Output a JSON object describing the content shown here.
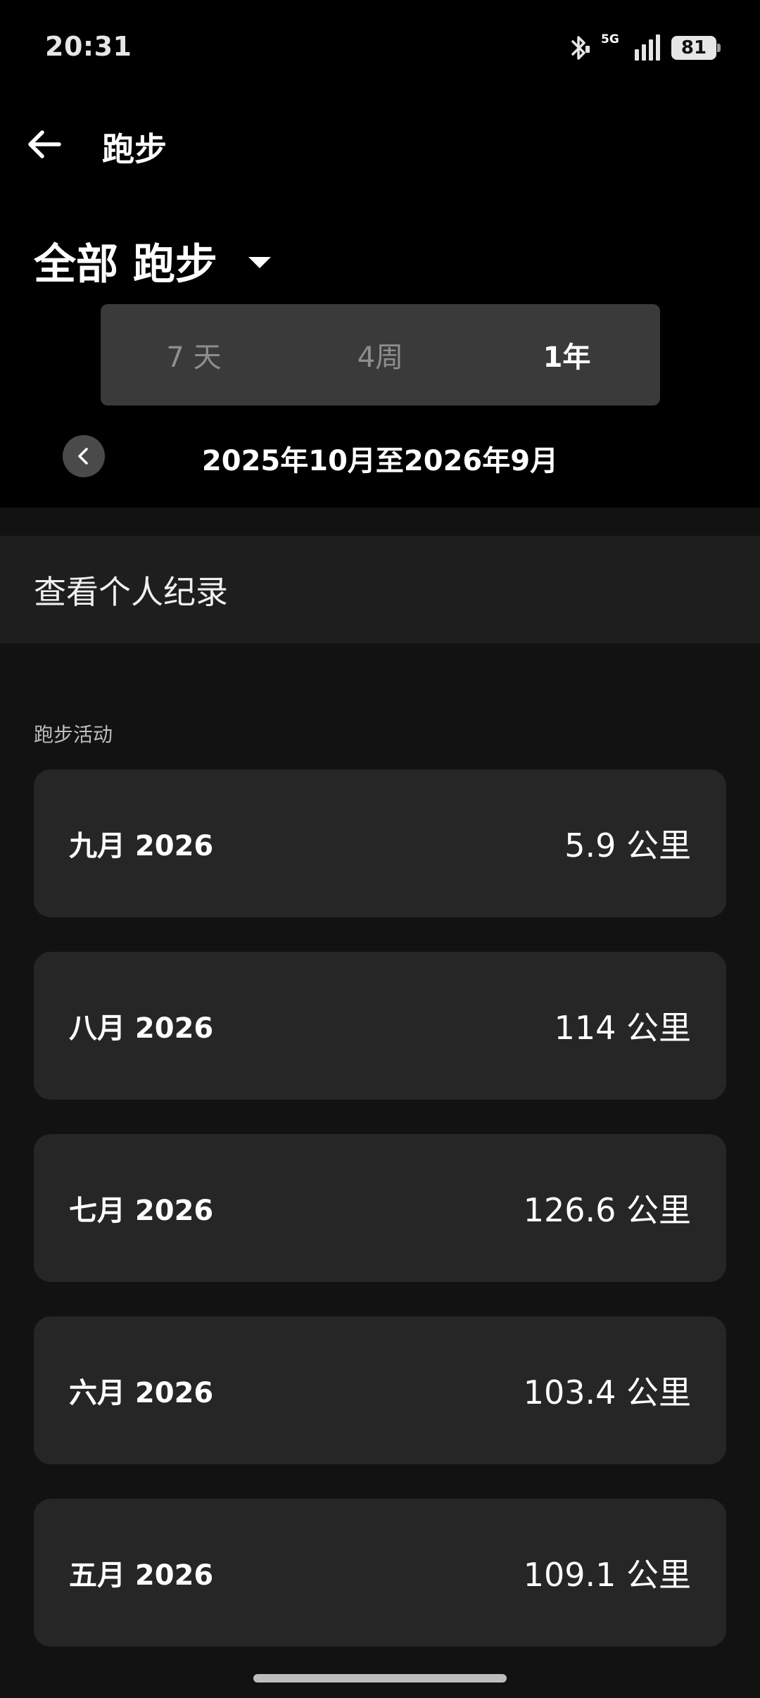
{
  "status_bar": {
    "time": "20:31",
    "network": "5G",
    "battery": "81",
    "icons": [
      "bluetooth-icon",
      "signal-icon",
      "battery-icon"
    ]
  },
  "header": {
    "title": "跑步",
    "back_icon": "arrow-left-icon"
  },
  "filter": {
    "label": "全部 跑步",
    "icon": "caret-down-icon"
  },
  "range_tabs": [
    {
      "label": "7 天",
      "selected": false
    },
    {
      "label": "4周",
      "selected": false
    },
    {
      "label": "1年",
      "selected": true
    }
  ],
  "period": {
    "label": "2025年10月至2026年9月",
    "prev_icon": "chevron-left-icon"
  },
  "personal_records": {
    "label": "查看个人纪录"
  },
  "activities": {
    "section_label": "跑步活动",
    "months": [
      {
        "month": "九月 2026",
        "distance": "5.9 公里"
      },
      {
        "month": "八月 2026",
        "distance": "114 公里"
      },
      {
        "month": "七月 2026",
        "distance": "126.6 公里"
      },
      {
        "month": "六月 2026",
        "distance": "103.4 公里"
      },
      {
        "month": "五月 2026",
        "distance": "109.1 公里"
      }
    ]
  },
  "colors": {
    "background": "#121212",
    "top_area": "#000000",
    "card": "#262626",
    "segmented_bg": "#3a3a3a",
    "inactive_text": "#8e8e8e"
  }
}
